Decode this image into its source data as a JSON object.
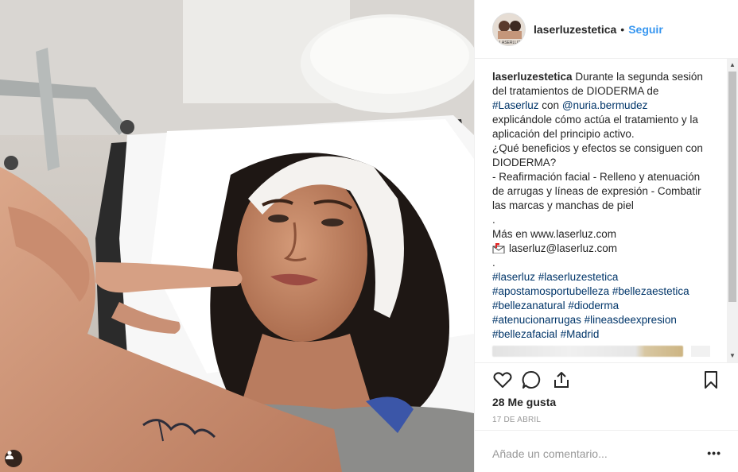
{
  "account": {
    "username": "laserluzestetica",
    "avatar_text": "LASERLUZ",
    "separator": "•",
    "follow_label": "Seguir"
  },
  "caption": {
    "user": "laserluzestetica",
    "l1": "Durante la segunda sesión",
    "l2": "del tratamientos de DIODERMA de",
    "l3_tag": "#Laserluz",
    "l3_mid": " con ",
    "l3_mention": "@nuria.bermudez",
    "l4": "explicándole cómo actúa el tratamiento y la",
    "l5": "aplicación del principio activo.",
    "l6": "¿Qué beneficios y efectos se consiguen con",
    "l7": "DIODERMA?",
    "l8": "- Reafirmación facial - Relleno y atenuación",
    "l9": "de arrugas y líneas de expresión - Combatir",
    "l10": "las marcas y manchas de piel",
    "l11": ".",
    "l12": "Más en www.laserluz.com",
    "l13": "laserluz@laserluz.com",
    "l14": ".",
    "h1": "#laserluz",
    "h2": "#laserluzestetica",
    "h3": "#apostamosportubelleza",
    "h4": "#bellezaestetica",
    "h5": "#bellezanatural",
    "h6": "#dioderma",
    "h7": "#atenucionarrugas",
    "h8": "#lineasdeexpresion",
    "h9": "#bellezafacial",
    "h10": "#Madrid"
  },
  "icons": {
    "like": "heart-icon",
    "comment": "comment-icon",
    "share": "share-icon",
    "save": "bookmark-icon",
    "mail": "mailbox-icon",
    "tag": "person-tag-icon",
    "more": "more-options-icon"
  },
  "stats": {
    "likes": "28 Me gusta",
    "date": "17 DE ABRIL"
  },
  "comment": {
    "placeholder": "Añade un comentario...",
    "more": "•••"
  },
  "scroll": {
    "up": "▲",
    "down": "▼"
  },
  "colors": {
    "link": "#003569",
    "follow": "#3897f0",
    "muted": "#999999"
  }
}
